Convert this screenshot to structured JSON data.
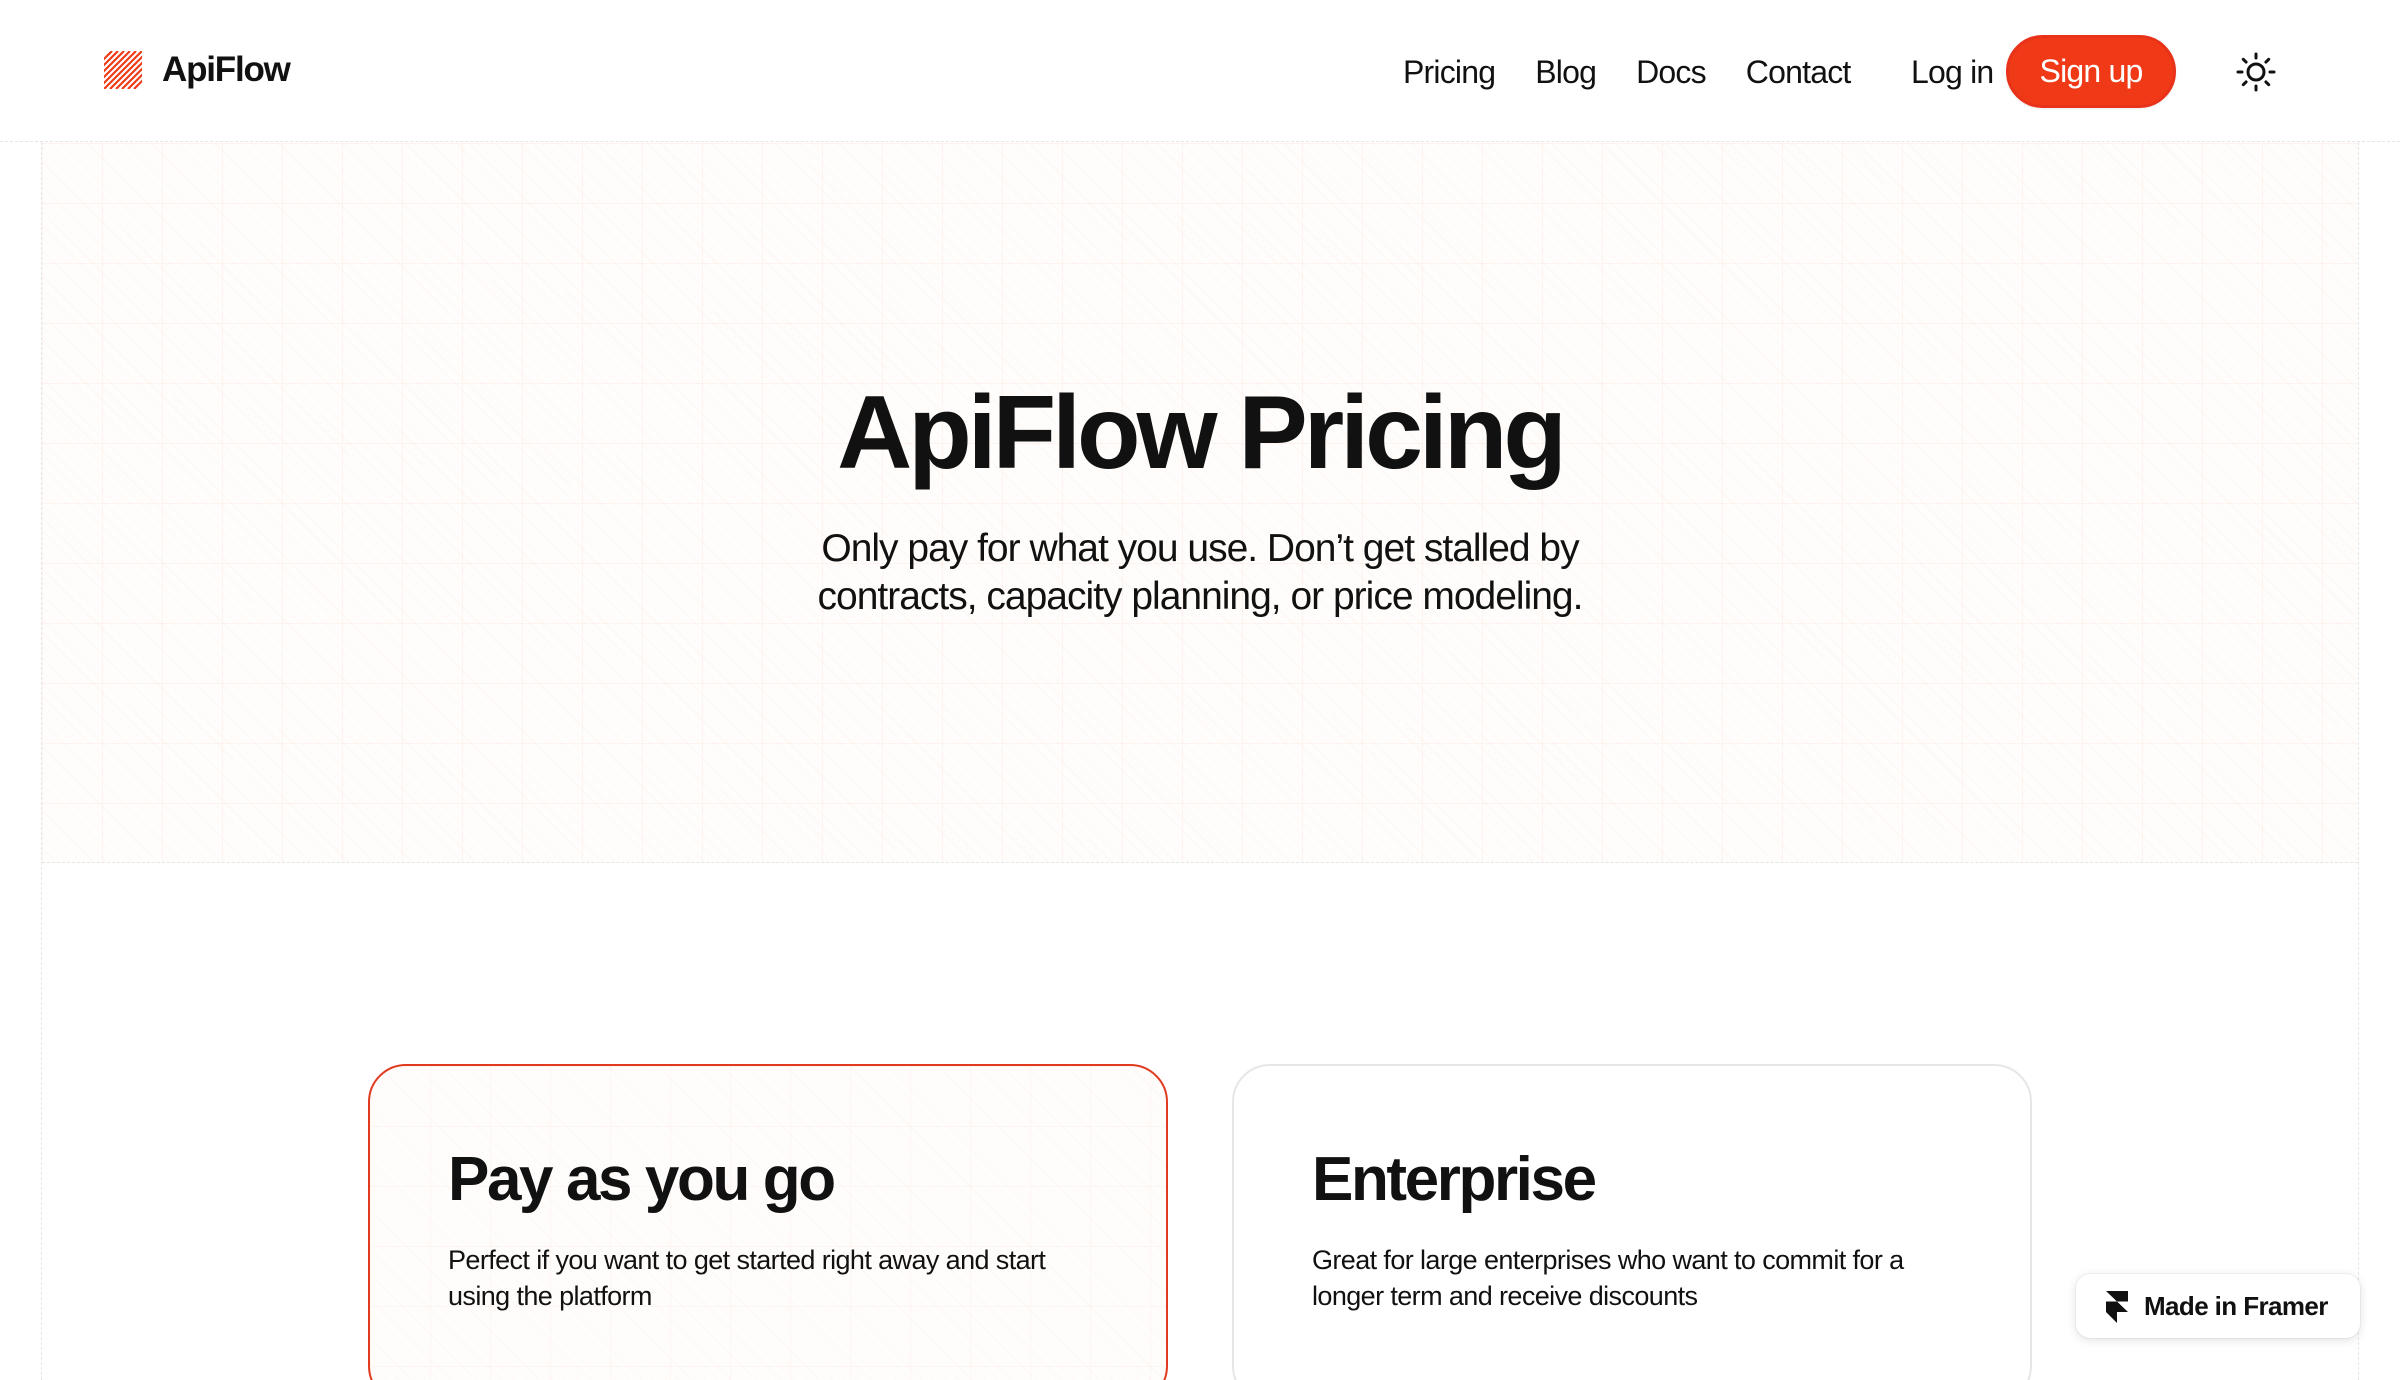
{
  "brand": {
    "name": "ApiFlow",
    "logo_icon": "diagonal-stripes-logo",
    "accent": "#f03a17"
  },
  "nav": {
    "links": [
      "Pricing",
      "Blog",
      "Docs",
      "Contact"
    ],
    "login_label": "Log in",
    "signup_label": "Sign up",
    "theme_icon": "sun-icon"
  },
  "hero": {
    "title": "ApiFlow Pricing",
    "subtitle_line1": "Only pay for what you use. Don’t get stalled by",
    "subtitle_line2": "contracts, capacity planning, or price modeling."
  },
  "plans": [
    {
      "name": "Pay as you go",
      "description": "Perfect if you want to get started right away and start using the platform",
      "featured": true
    },
    {
      "name": "Enterprise",
      "description": "Great for large enterprises who want to commit for a longer term and receive discounts",
      "featured": false
    }
  ],
  "badge": {
    "label": "Made in Framer",
    "icon": "framer-icon"
  }
}
